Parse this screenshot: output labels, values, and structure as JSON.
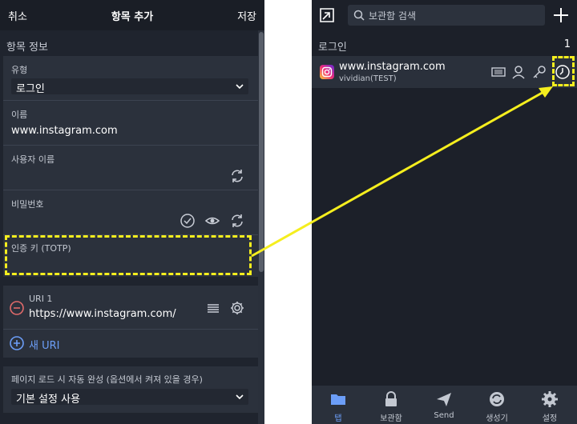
{
  "left": {
    "header": {
      "cancel": "취소",
      "title": "항목 추가",
      "save": "저장"
    },
    "section_title": "항목 정보",
    "type": {
      "label": "유형",
      "value": "로그인"
    },
    "name": {
      "label": "이름",
      "value": "www.instagram.com"
    },
    "username": {
      "label": "사용자 이름"
    },
    "password": {
      "label": "비밀번호"
    },
    "totp": {
      "label": "인증 키 (TOTP)"
    },
    "uri": {
      "label": "URI 1",
      "value": "https://www.instagram.com/",
      "new_uri": "새 URI"
    },
    "autofill": {
      "label": "페이지 로드 시 자동 완성 (옵션에서 켜져 있을 경우)",
      "value": "기본 설정 사용"
    }
  },
  "right": {
    "search_placeholder": "보관함 검색",
    "category": "로그인",
    "count": "1",
    "item": {
      "name": "www.instagram.com",
      "sub": "vividian(TEST)"
    },
    "tabs": [
      {
        "label": "탭"
      },
      {
        "label": "보관함"
      },
      {
        "label": "Send"
      },
      {
        "label": "생성기"
      },
      {
        "label": "설정"
      }
    ]
  },
  "colors": {
    "highlight": "#f5ee1e",
    "accent": "#6c9ef8",
    "panel": "#1f242e",
    "card": "#2b313c"
  }
}
